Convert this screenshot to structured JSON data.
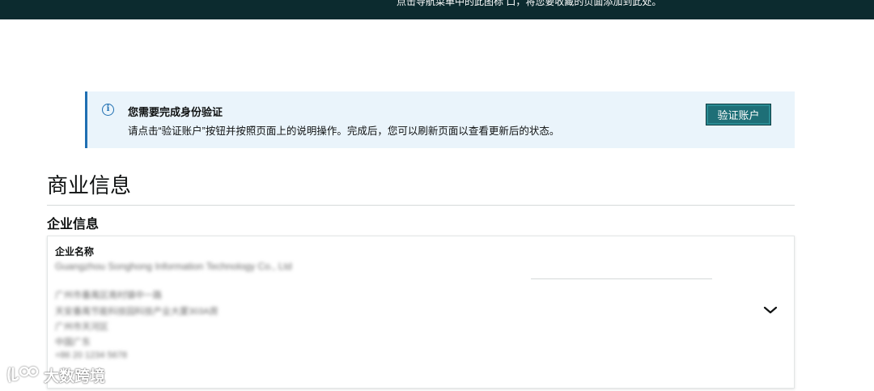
{
  "top_banner": {
    "text": "点击导航菜单中的此图标 口，将您要收藏的页面添加到此处。"
  },
  "alert": {
    "icon": "info-icon",
    "title": "您需要完成身份验证",
    "message": "请点击“验证账户”按钮并按照页面上的说明操作。完成后，您可以刷新页面以查看更新后的状态。",
    "button_label": "验证账户"
  },
  "page": {
    "title": "商业信息"
  },
  "business_section": {
    "title": "企业信息",
    "company_name_label": "企业名称",
    "company_name_value": "Guangzhou Songhong Information Technology Co., Ltd",
    "address_lines": [
      "广州市番禺区南村镇中一路",
      "天安番禺节能科技园科技产业大厦303A房",
      "广州市天河区",
      "中国广东",
      "+86 20 1234 5678"
    ],
    "expand_icon": "chevron-down-icon"
  },
  "watermark": {
    "text": "大数跨境"
  }
}
